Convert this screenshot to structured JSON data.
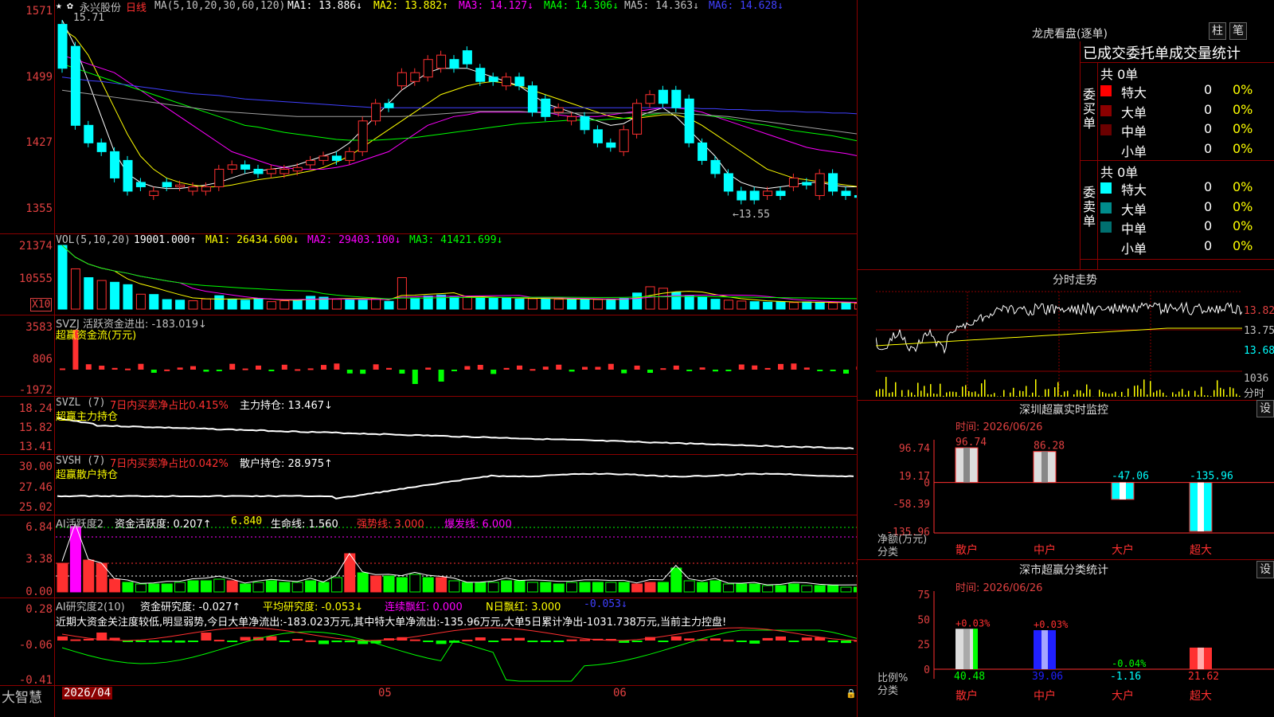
{
  "stock": {
    "name": "永兴股份",
    "period": "日线",
    "ma_header": "MA(5,10,20,30,60,120)",
    "ma": [
      {
        "label": "MA1: 13.886↓",
        "color": "#ffffff"
      },
      {
        "label": "MA2: 13.882↑",
        "color": "#ffff00"
      },
      {
        "label": "MA3: 14.127↓",
        "color": "#ff00ff"
      },
      {
        "label": "MA4: 14.306↓",
        "color": "#00ff00"
      },
      {
        "label": "MA5: 14.363↓",
        "color": "#c0c0c0"
      },
      {
        "label": "MA6: 14.628↓",
        "color": "#4040ff"
      }
    ],
    "yticks": [
      "1571",
      "1499",
      "1427",
      "1355"
    ],
    "high_label": "15.71",
    "low_label": "←13.55"
  },
  "vol": {
    "header": "VOL(5,10,20)",
    "value": "19001.000↑",
    "ma1": "MA1: 26434.600↓",
    "ma2": "MA2: 29403.100↓",
    "ma3": "MA3: 41421.699↓",
    "yticks": [
      "21374",
      "10555"
    ],
    "unit": "X10"
  },
  "svzj": {
    "header": "SVZJ 活跃资金进出: -183.019↓",
    "sub": "超赢资金流(万元)",
    "yticks": [
      "3583",
      "806",
      "-1972"
    ]
  },
  "svzl": {
    "header": "SVZL (7)",
    "ratio": "7日内买卖净占比0.415%",
    "hold": "主力持仓: 13.467↓",
    "sub": "超赢主力持仓",
    "yticks": [
      "18.24",
      "15.82",
      "13.41"
    ]
  },
  "svsh": {
    "header": "SVSH (7)",
    "ratio": "7日内买卖净占比0.042%",
    "hold": "散户持仓: 28.975↑",
    "sub": "超赢散户持仓",
    "yticks": [
      "30.00",
      "27.46",
      "25.02"
    ]
  },
  "ai1": {
    "header": "AI活跃度2",
    "act": "资金活跃度: 0.207↑",
    "v2": "6.840",
    "life": "生命线: 1.560",
    "strong": "强势线: 3.000",
    "burst": "爆发线: 6.000",
    "yticks": [
      "6.84",
      "3.38",
      "0.00"
    ]
  },
  "ai2": {
    "header": "AI研究度2(10)",
    "res": "资金研究度: -0.027↑",
    "avg": "平均研究度: -0.053↓",
    "red": "连续飘红: 0.000",
    "nred": "N日飘红: 3.000",
    "last": "-0.053↓",
    "note": "近期大资金关注度较低,明显弱势,今日大单净流出:-183.023万元,其中特大单净流出:-135.96万元,大单5日累计净出-1031.738万元,当前主力控盘!",
    "yticks": [
      "0.28",
      "-0.06",
      "-0.41"
    ]
  },
  "xaxis": {
    "logo": "大智慧",
    "dates": [
      "2026/04",
      "05",
      "06"
    ]
  },
  "dragon": {
    "title": "龙虎看盘(逐单)",
    "btn1": "柱",
    "btn2": "笔",
    "subtitle": "已成交委托单成交量统计",
    "buy_label": "委买单",
    "sell_label": "委卖单",
    "buy_total": "共 0单",
    "sell_total": "共 0单",
    "buy_rows": [
      {
        "name": "特大",
        "v": "0",
        "p": "0%",
        "c": "#ff0000"
      },
      {
        "name": "大单",
        "v": "0",
        "p": "0%",
        "c": "#8b0000"
      },
      {
        "name": "中单",
        "v": "0",
        "p": "0%",
        "c": "#6b0000"
      },
      {
        "name": "小单",
        "v": "0",
        "p": "0%",
        "c": "#000000"
      }
    ],
    "sell_rows": [
      {
        "name": "特大",
        "v": "0",
        "p": "0%",
        "c": "#00ffff"
      },
      {
        "name": "大单",
        "v": "0",
        "p": "0%",
        "c": "#008b8b"
      },
      {
        "name": "中单",
        "v": "0",
        "p": "0%",
        "c": "#007070"
      },
      {
        "name": "小单",
        "v": "0",
        "p": "0%",
        "c": "#000000"
      }
    ]
  },
  "intraday": {
    "title": "分时走势",
    "prices": [
      "13.82",
      "13.75",
      "13.68"
    ],
    "vol_label": "1036",
    "vol_unit": "分时"
  },
  "monitor": {
    "title": "深圳超赢实时监控",
    "btn": "设",
    "time": "时间: 2026/06/26",
    "yticks": [
      "96.74",
      "19.17",
      "0",
      "-58.39",
      "-135.96"
    ],
    "ylabel": "净额(万元)",
    "xlabel": "分类",
    "cats": [
      "散户",
      "中户",
      "大户",
      "超大"
    ],
    "values": [
      96.74,
      86.28,
      -47.06,
      -135.96
    ],
    "vlabels": [
      "96.74",
      "86.28",
      "-47.06",
      "-135.96"
    ]
  },
  "classify": {
    "title": "深市超赢分类统计",
    "btn": "设",
    "time": "时间: 2026/06/26",
    "yticks": [
      "75",
      "50",
      "25",
      "0"
    ],
    "ylabel": "比例%",
    "xlabel": "分类",
    "cats": [
      "散户",
      "中户",
      "大户",
      "超大"
    ],
    "values": [
      40.48,
      39.06,
      -1.16,
      21.62
    ],
    "vlabels": [
      "40.48",
      "39.06",
      "-1.16",
      "21.62"
    ],
    "toplabels": [
      "+0.03%",
      "+0.03%",
      "-0.04%",
      ""
    ]
  },
  "chart_data": [
    {
      "type": "bar",
      "title": "深圳超赢实时监控",
      "ylabel": "净额(万元)",
      "xlabel": "分类",
      "categories": [
        "散户",
        "中户",
        "大户",
        "超大"
      ],
      "values": [
        96.74,
        86.28,
        -47.06,
        -135.96
      ],
      "ylim": [
        -135.96,
        96.74
      ]
    },
    {
      "type": "bar",
      "title": "深市超赢分类统计",
      "ylabel": "比例%",
      "xlabel": "分类",
      "categories": [
        "散户",
        "中户",
        "大户",
        "超大"
      ],
      "values": [
        40.48,
        39.06,
        -1.16,
        21.62
      ],
      "ylim": [
        0,
        75
      ]
    },
    {
      "type": "bar",
      "title": "VOL(5,10,20)",
      "values": [
        21374,
        13500,
        10555,
        9600,
        9000,
        8200,
        5000,
        4900,
        3200,
        3000,
        2800,
        3400,
        4500,
        3300,
        3000,
        3600,
        2500,
        2800,
        3000,
        4300,
        4000,
        3300,
        3100,
        3000,
        3600,
        2600,
        10555,
        3700,
        4400,
        4700,
        4000,
        4000,
        3800,
        3600,
        3900,
        3400,
        3500,
        3400,
        3300,
        3400,
        3300,
        3200,
        3000,
        3600,
        5400,
        7500,
        7000,
        5600,
        4400,
        4200,
        3300,
        3000,
        2700,
        2500,
        2300,
        2400,
        2200,
        2400,
        2200,
        2100,
        2000,
        1900,
        1700
      ]
    }
  ]
}
